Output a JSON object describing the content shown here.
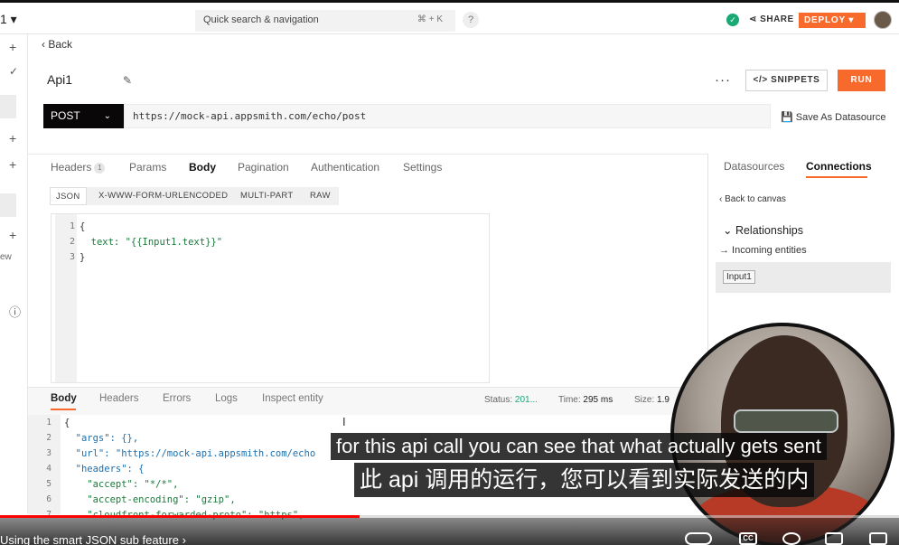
{
  "topbar": {
    "app_fragment": "1 ▾",
    "search_placeholder": "Quick search & navigation",
    "search_shortcut": "⌘ + K",
    "help": "?",
    "share": "SHARE",
    "deploy": "DEPLOY ▾"
  },
  "header": {
    "back": "Back",
    "api_name": "Api1",
    "snippets": "</> SNIPPETS",
    "run": "RUN"
  },
  "request": {
    "method": "POST",
    "url": "https://mock-api.appsmith.com/echo/post",
    "save_as_datasource": "Save As Datasource"
  },
  "tabs": {
    "headers": "Headers",
    "headers_count": "1",
    "params": "Params",
    "body": "Body",
    "pagination": "Pagination",
    "authentication": "Authentication",
    "settings": "Settings"
  },
  "body_types": [
    "JSON",
    "X-WWW-FORM-URLENCODED",
    "MULTI-PART",
    "RAW"
  ],
  "editor": {
    "lines": [
      "{",
      "  text: \"{{Input1.text}}\"",
      "}"
    ],
    "numbers": [
      "1",
      "2",
      "3"
    ]
  },
  "right_panel": {
    "datasources": "Datasources",
    "connections": "Connections",
    "back_to_canvas": "Back to canvas",
    "relationships": "Relationships",
    "incoming": "→ Incoming entities",
    "entity": "Input1"
  },
  "left_rail_fragment": "ew",
  "response": {
    "tabs": [
      "Body",
      "Headers",
      "Errors",
      "Logs",
      "Inspect entity"
    ],
    "status_label": "Status:",
    "status_value": "201...",
    "time_label": "Time:",
    "time_value": "295 ms",
    "size_label": "Size:",
    "size_value": "1.9",
    "line_numbers": [
      "1",
      "2",
      "3",
      "4",
      "5",
      "6",
      "7"
    ],
    "lines": [
      "{",
      "  \"args\": {},",
      "  \"url\": \"https://mock-api.appsmith.com/echo",
      "  \"headers\": {",
      "    \"accept\": \"*/*\",",
      "    \"accept-encoding\": \"gzip\",",
      "    \"cloudfront-forwarded-proto\": \"https\","
    ]
  },
  "captions": {
    "english": "for this api call you can see that what actually gets sent",
    "chinese": "此 api 调用的运行，您可以看到实际发送的内"
  },
  "video": {
    "chapter": "Using the smart JSON sub feature ›",
    "progress": 0.4,
    "cc": "CC"
  },
  "colors": {
    "accent": "#f86a2b",
    "success": "#19a974",
    "progress": "#ff0000"
  }
}
